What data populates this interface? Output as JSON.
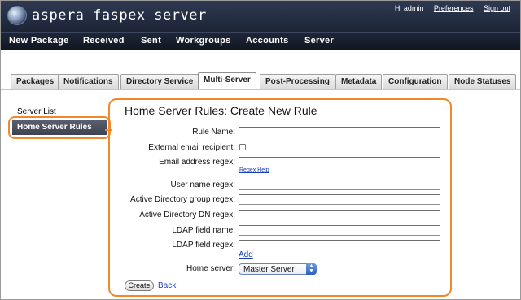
{
  "header": {
    "logo_text": "aspera faspex server",
    "greeting": "Hi admin",
    "preferences": "Preferences",
    "sign_out": "Sign out"
  },
  "main_nav": [
    "New Package",
    "Received",
    "Sent",
    "Workgroups",
    "Accounts",
    "Server"
  ],
  "tabs": [
    "Packages",
    "Notifications",
    "Directory Service",
    "Multi-Server",
    "Post-Processing",
    "Metadata",
    "Configuration",
    "Node Statuses"
  ],
  "active_tab": "Multi-Server",
  "sidebar": {
    "items": [
      "Server List",
      "Home Server Rules"
    ],
    "active": "Home Server Rules"
  },
  "form": {
    "title": "Home Server Rules: Create New Rule",
    "rule_name_label": "Rule Name:",
    "external_email_label": "External email recipient:",
    "email_regex_label": "Email address regex:",
    "regex_help": "Regex Help",
    "user_regex_label": "User name regex:",
    "ad_group_label": "Active Directory group regex:",
    "ad_dn_label": "Active Directory DN regex:",
    "ldap_name_label": "LDAP field name:",
    "ldap_regex_label": "LDAP field regex:",
    "add_link": "Add",
    "home_server_label": "Home server:",
    "home_server_value": "Master Server",
    "create_button": "Create",
    "back_link": "Back"
  },
  "colors": {
    "highlight": "#f0892b",
    "header_bg": "#2e3a52",
    "link": "#1a3fb0"
  }
}
